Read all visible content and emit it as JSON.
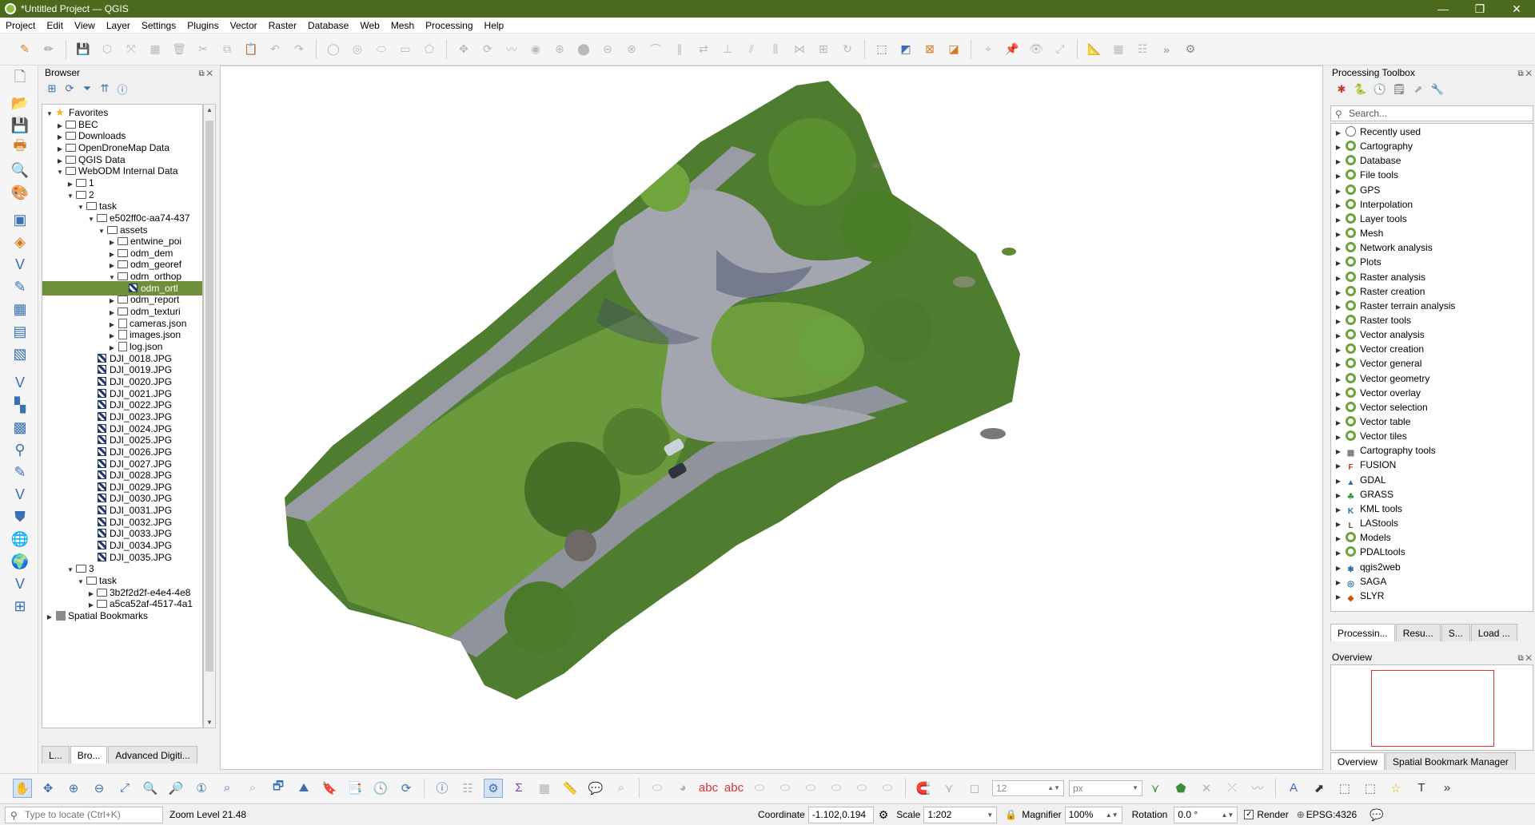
{
  "window": {
    "title": "*Untitled Project — QGIS",
    "controls": [
      "—",
      "❐",
      "✕"
    ]
  },
  "menu": [
    "Project",
    "Edit",
    "View",
    "Layer",
    "Settings",
    "Plugins",
    "Vector",
    "Raster",
    "Database",
    "Web",
    "Mesh",
    "Processing",
    "Help"
  ],
  "browser": {
    "title": "Browser",
    "tree": [
      {
        "label": "Favorites",
        "depth": 0,
        "icon": "star",
        "arrow": "▼"
      },
      {
        "label": "BEC",
        "depth": 1,
        "icon": "folder",
        "arrow": "▶"
      },
      {
        "label": "Downloads",
        "depth": 1,
        "icon": "folder",
        "arrow": "▶"
      },
      {
        "label": "OpenDroneMap Data",
        "depth": 1,
        "icon": "folder",
        "arrow": "▶"
      },
      {
        "label": "QGIS Data",
        "depth": 1,
        "icon": "folder",
        "arrow": "▶"
      },
      {
        "label": "WebODM Internal Data",
        "depth": 1,
        "icon": "folder",
        "arrow": "▼"
      },
      {
        "label": "1",
        "depth": 2,
        "icon": "folder",
        "arrow": "▶"
      },
      {
        "label": "2",
        "depth": 2,
        "icon": "folder",
        "arrow": "▼"
      },
      {
        "label": "task",
        "depth": 3,
        "icon": "folder",
        "arrow": "▼"
      },
      {
        "label": "e502ff0c-aa74-437",
        "depth": 4,
        "icon": "folder",
        "arrow": "▼"
      },
      {
        "label": "assets",
        "depth": 5,
        "icon": "folder",
        "arrow": "▼"
      },
      {
        "label": "entwine_poi",
        "depth": 6,
        "icon": "folder",
        "arrow": "▶"
      },
      {
        "label": "odm_dem",
        "depth": 6,
        "icon": "folder",
        "arrow": "▶"
      },
      {
        "label": "odm_georef",
        "depth": 6,
        "icon": "folder",
        "arrow": "▶"
      },
      {
        "label": "odm_orthop",
        "depth": 6,
        "icon": "folder",
        "arrow": "▼"
      },
      {
        "label": "odm_ortl",
        "depth": 7,
        "icon": "raster",
        "arrow": "",
        "selected": true
      },
      {
        "label": "odm_report",
        "depth": 6,
        "icon": "folder",
        "arrow": "▶"
      },
      {
        "label": "odm_texturi",
        "depth": 6,
        "icon": "folder",
        "arrow": "▶"
      },
      {
        "label": "cameras.json",
        "depth": 6,
        "icon": "file",
        "arrow": "▶"
      },
      {
        "label": "images.json",
        "depth": 6,
        "icon": "file",
        "arrow": "▶"
      },
      {
        "label": "log.json",
        "depth": 6,
        "icon": "file",
        "arrow": "▶"
      },
      {
        "label": "DJI_0018.JPG",
        "depth": 4,
        "icon": "raster",
        "arrow": ""
      },
      {
        "label": "DJI_0019.JPG",
        "depth": 4,
        "icon": "raster",
        "arrow": ""
      },
      {
        "label": "DJI_0020.JPG",
        "depth": 4,
        "icon": "raster",
        "arrow": ""
      },
      {
        "label": "DJI_0021.JPG",
        "depth": 4,
        "icon": "raster",
        "arrow": ""
      },
      {
        "label": "DJI_0022.JPG",
        "depth": 4,
        "icon": "raster",
        "arrow": ""
      },
      {
        "label": "DJI_0023.JPG",
        "depth": 4,
        "icon": "raster",
        "arrow": ""
      },
      {
        "label": "DJI_0024.JPG",
        "depth": 4,
        "icon": "raster",
        "arrow": ""
      },
      {
        "label": "DJI_0025.JPG",
        "depth": 4,
        "icon": "raster",
        "arrow": ""
      },
      {
        "label": "DJI_0026.JPG",
        "depth": 4,
        "icon": "raster",
        "arrow": ""
      },
      {
        "label": "DJI_0027.JPG",
        "depth": 4,
        "icon": "raster",
        "arrow": ""
      },
      {
        "label": "DJI_0028.JPG",
        "depth": 4,
        "icon": "raster",
        "arrow": ""
      },
      {
        "label": "DJI_0029.JPG",
        "depth": 4,
        "icon": "raster",
        "arrow": ""
      },
      {
        "label": "DJI_0030.JPG",
        "depth": 4,
        "icon": "raster",
        "arrow": ""
      },
      {
        "label": "DJI_0031.JPG",
        "depth": 4,
        "icon": "raster",
        "arrow": ""
      },
      {
        "label": "DJI_0032.JPG",
        "depth": 4,
        "icon": "raster",
        "arrow": ""
      },
      {
        "label": "DJI_0033.JPG",
        "depth": 4,
        "icon": "raster",
        "arrow": ""
      },
      {
        "label": "DJI_0034.JPG",
        "depth": 4,
        "icon": "raster",
        "arrow": ""
      },
      {
        "label": "DJI_0035.JPG",
        "depth": 4,
        "icon": "raster",
        "arrow": ""
      },
      {
        "label": "3",
        "depth": 2,
        "icon": "folder",
        "arrow": "▼"
      },
      {
        "label": "task",
        "depth": 3,
        "icon": "folder",
        "arrow": "▼"
      },
      {
        "label": "3b2f2d2f-e4e4-4e8",
        "depth": 4,
        "icon": "folder",
        "arrow": "▶"
      },
      {
        "label": "a5ca52af-4517-4a1",
        "depth": 4,
        "icon": "folder",
        "arrow": "▶"
      },
      {
        "label": "Spatial Bookmarks",
        "depth": 0,
        "icon": "bookmark",
        "arrow": "▶"
      }
    ],
    "tabs": [
      "L...",
      "Bro...",
      "Advanced Digiti..."
    ],
    "active_tab": 1
  },
  "processing": {
    "title": "Processing Toolbox",
    "search_placeholder": "Search...",
    "items": [
      {
        "label": "Recently used",
        "icon": "clock"
      },
      {
        "label": "Cartography",
        "icon": "qgis"
      },
      {
        "label": "Database",
        "icon": "qgis"
      },
      {
        "label": "File tools",
        "icon": "qgis"
      },
      {
        "label": "GPS",
        "icon": "qgis"
      },
      {
        "label": "Interpolation",
        "icon": "qgis"
      },
      {
        "label": "Layer tools",
        "icon": "qgis"
      },
      {
        "label": "Mesh",
        "icon": "qgis"
      },
      {
        "label": "Network analysis",
        "icon": "qgis"
      },
      {
        "label": "Plots",
        "icon": "qgis"
      },
      {
        "label": "Raster analysis",
        "icon": "qgis"
      },
      {
        "label": "Raster creation",
        "icon": "qgis"
      },
      {
        "label": "Raster terrain analysis",
        "icon": "qgis"
      },
      {
        "label": "Raster tools",
        "icon": "qgis"
      },
      {
        "label": "Vector analysis",
        "icon": "qgis"
      },
      {
        "label": "Vector creation",
        "icon": "qgis"
      },
      {
        "label": "Vector general",
        "icon": "qgis"
      },
      {
        "label": "Vector geometry",
        "icon": "qgis"
      },
      {
        "label": "Vector overlay",
        "icon": "qgis"
      },
      {
        "label": "Vector selection",
        "icon": "qgis"
      },
      {
        "label": "Vector table",
        "icon": "qgis"
      },
      {
        "label": "Vector tiles",
        "icon": "qgis"
      },
      {
        "label": "Cartography tools",
        "icon": "cartography-tools"
      },
      {
        "label": "FUSION",
        "icon": "fusion"
      },
      {
        "label": "GDAL",
        "icon": "gdal"
      },
      {
        "label": "GRASS",
        "icon": "grass"
      },
      {
        "label": "KML tools",
        "icon": "kml"
      },
      {
        "label": "LAStools",
        "icon": "lastools"
      },
      {
        "label": "Models",
        "icon": "qgis"
      },
      {
        "label": "PDALtools",
        "icon": "qgis"
      },
      {
        "label": "qgis2web",
        "icon": "qgis2web"
      },
      {
        "label": "SAGA",
        "icon": "saga"
      },
      {
        "label": "SLYR",
        "icon": "slyr"
      }
    ],
    "tabs": [
      "Processin...",
      "Resu...",
      "S...",
      "Load ..."
    ],
    "active_tab": 0
  },
  "overview": {
    "title": "Overview",
    "tabs": [
      "Overview",
      "Spatial Bookmark Manager"
    ],
    "active_tab": 0
  },
  "bottom_toolbar": {
    "snap_tolerance": "12",
    "snap_units": "px"
  },
  "status": {
    "locate_placeholder": "Type to locate (Ctrl+K)",
    "zoom_text": "Zoom Level 21.48",
    "coordinate_label": "Coordinate",
    "coordinate_value": "-1.102,0.194",
    "scale_label": "Scale",
    "scale_value": "1:202",
    "magnifier_label": "Magnifier",
    "magnifier_value": "100%",
    "rotation_label": "Rotation",
    "rotation_value": "0.0 °",
    "render_label": "Render",
    "crs": "EPSG:4326"
  },
  "colors": {
    "titlebar": "#4b6a1d",
    "selection": "#6f8f3a",
    "grass": "#5f8f3a",
    "road": "#9a9ca5"
  }
}
